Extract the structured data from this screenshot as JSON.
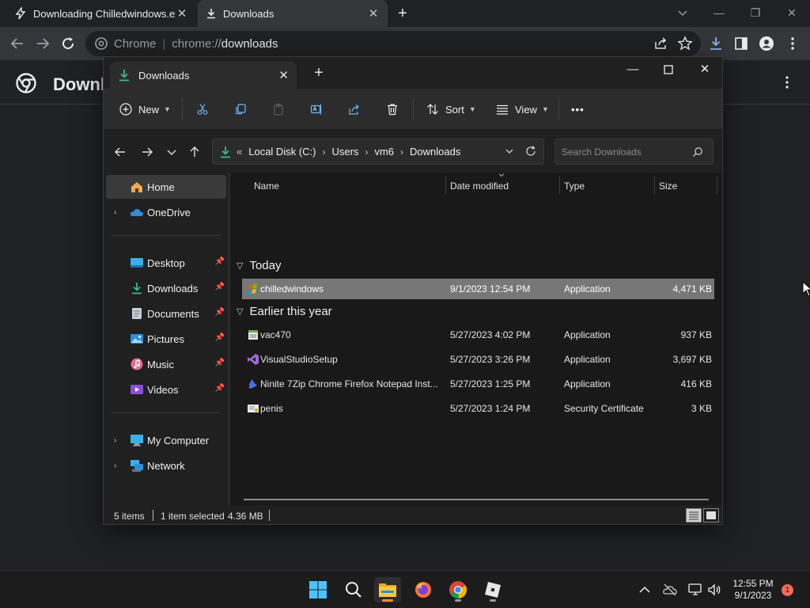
{
  "browser": {
    "tabs": [
      {
        "title": "Downloading Chilledwindows.exe",
        "close": "✕"
      },
      {
        "title": "Downloads",
        "close": "✕"
      }
    ],
    "new_tab": "+",
    "window_controls": {
      "minimize": "—",
      "restore": "❐",
      "close": "✕"
    },
    "omnibox": {
      "site": "Chrome",
      "scheme": "chrome://",
      "host": "downloads"
    },
    "page_title": "Downloads"
  },
  "explorer": {
    "tab_title": "Downloads",
    "new_tab": "+",
    "commands": {
      "new": "New",
      "sort": "Sort",
      "view": "View",
      "more": "•••"
    },
    "address": {
      "overflow": "«",
      "crumbs": [
        "Local Disk (C:)",
        "Users",
        "vm6",
        "Downloads"
      ]
    },
    "search_placeholder": "Search Downloads",
    "nav": {
      "home": "Home",
      "onedrive": "OneDrive",
      "desktop": "Desktop",
      "downloads": "Downloads",
      "documents": "Documents",
      "pictures": "Pictures",
      "music": "Music",
      "videos": "Videos",
      "my_computer": "My Computer",
      "network": "Network"
    },
    "columns": {
      "name": "Name",
      "date": "Date modified",
      "type": "Type",
      "size": "Size"
    },
    "groups": {
      "today": "Today",
      "earlier": "Earlier this year"
    },
    "files_today": [
      {
        "name": "chilledwindows",
        "date": "9/1/2023 12:54 PM",
        "type": "Application",
        "size": "4,471 KB",
        "icon": "app-colorful-icon"
      }
    ],
    "files_earlier": [
      {
        "name": "vac470",
        "date": "5/27/2023 4:02 PM",
        "type": "Application",
        "size": "937 KB",
        "icon": "installer-icon"
      },
      {
        "name": "VisualStudioSetup",
        "date": "5/27/2023 3:26 PM",
        "type": "Application",
        "size": "3,697 KB",
        "icon": "visual-studio-icon"
      },
      {
        "name": "Ninite 7Zip Chrome Firefox Notepad Inst...",
        "date": "5/27/2023 1:25 PM",
        "type": "Application",
        "size": "416 KB",
        "icon": "ninite-icon"
      },
      {
        "name": "penis",
        "date": "5/27/2023 1:24 PM",
        "type": "Security Certificate",
        "size": "3 KB",
        "icon": "certificate-icon"
      }
    ],
    "status": {
      "items": "5 items",
      "selected": "1 item selected",
      "selected_size": "4.36 MB"
    }
  },
  "taskbar": {
    "clock_time": "12:55 PM",
    "clock_date": "9/1/2023",
    "notification_count": "1"
  },
  "colors": {
    "chrome_dark": "#202124",
    "explorer_bg": "#191919",
    "selected_row": "#777777",
    "accent_green": "#3fb68b",
    "notif_badge": "#f26b5b"
  }
}
